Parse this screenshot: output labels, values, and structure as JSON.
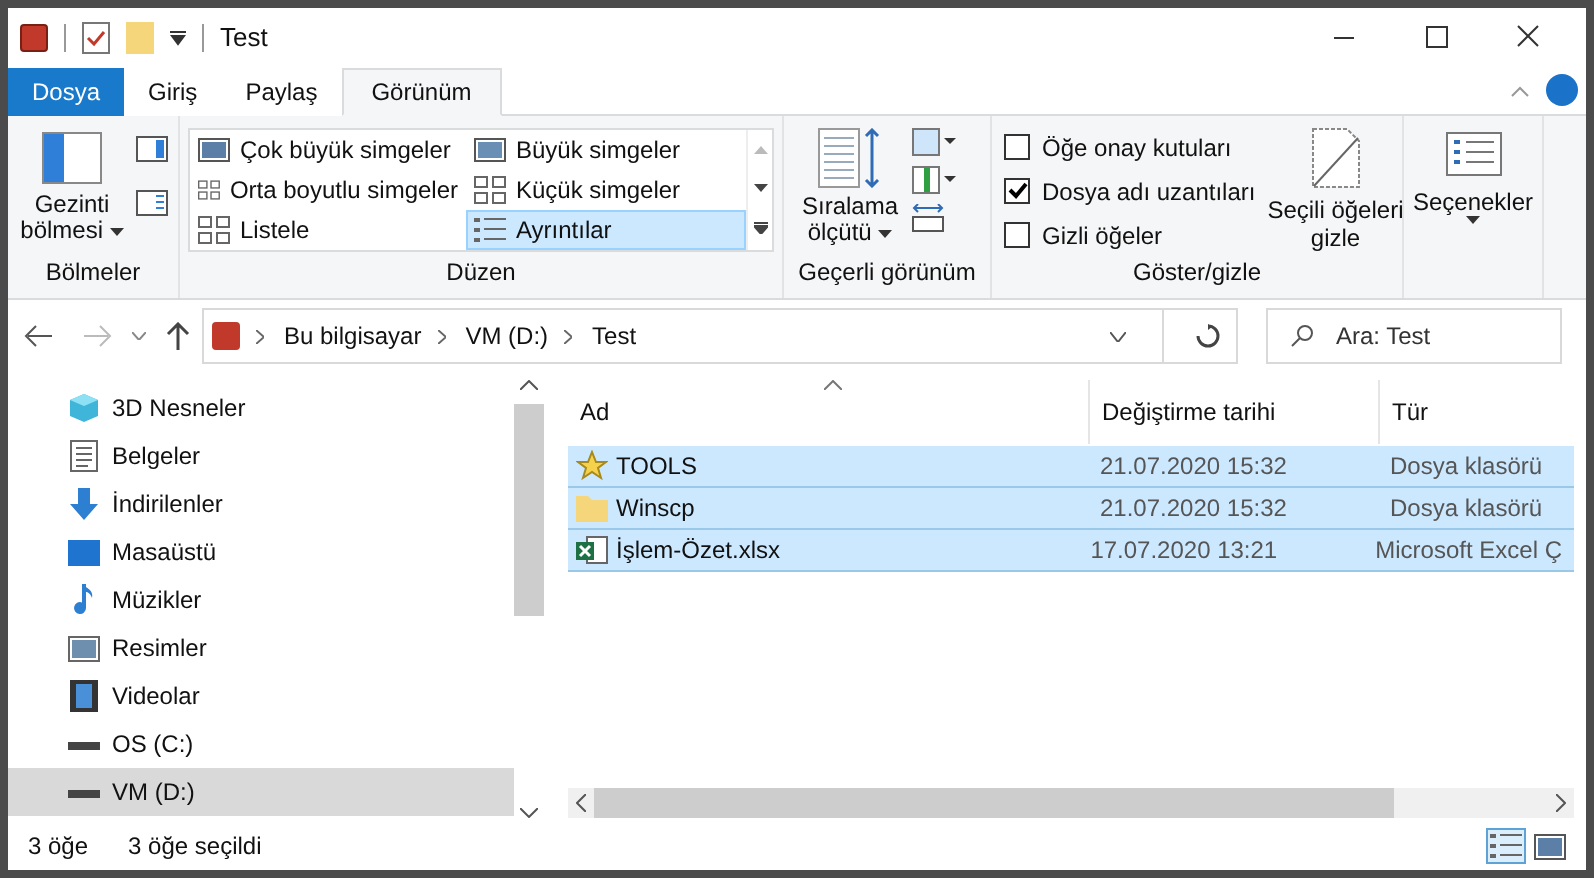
{
  "window": {
    "title": "Test"
  },
  "tabs": [
    {
      "label": "Dosya",
      "kind": "file",
      "selected": false
    },
    {
      "label": "Giriş",
      "kind": "normal",
      "selected": false
    },
    {
      "label": "Paylaş",
      "kind": "normal",
      "selected": false
    },
    {
      "label": "Görünüm",
      "kind": "normal",
      "selected": true
    }
  ],
  "ribbon": {
    "panes": {
      "nav_label": "Gezinti bölmesi",
      "group": "Bölmeler"
    },
    "layout": {
      "group": "Düzen",
      "options": [
        {
          "label": "Çok büyük simgeler",
          "selected": false
        },
        {
          "label": "Büyük simgeler",
          "selected": false
        },
        {
          "label": "Orta boyutlu simgeler",
          "selected": false
        },
        {
          "label": "Küçük simgeler",
          "selected": false
        },
        {
          "label": "Listele",
          "selected": false
        },
        {
          "label": "Ayrıntılar",
          "selected": true
        }
      ]
    },
    "current_view": {
      "sort_label": "Sıralama ölçütü",
      "group": "Geçerli görünüm"
    },
    "show_hide": {
      "group": "Göster/gizle",
      "checkboxes": [
        {
          "label": "Öğe onay kutuları",
          "checked": false
        },
        {
          "label": "Dosya adı uzantıları",
          "checked": true
        },
        {
          "label": "Gizli öğeler",
          "checked": false
        }
      ],
      "hide_selected": "Seçili öğeleri gizle"
    },
    "options": {
      "label": "Seçenekler"
    }
  },
  "address": {
    "crumbs": [
      "Bu bilgisayar",
      "VM (D:)",
      "Test"
    ],
    "search_placeholder": "Ara: Test"
  },
  "sidebar": {
    "items": [
      {
        "label": "3D Nesneler",
        "kind": "cube",
        "selected": false
      },
      {
        "label": "Belgeler",
        "kind": "doc",
        "selected": false
      },
      {
        "label": "İndirilenler",
        "kind": "download",
        "selected": false
      },
      {
        "label": "Masaüstü",
        "kind": "desktop",
        "selected": false
      },
      {
        "label": "Müzikler",
        "kind": "music",
        "selected": false
      },
      {
        "label": "Resimler",
        "kind": "picture",
        "selected": false
      },
      {
        "label": "Videolar",
        "kind": "video",
        "selected": false
      },
      {
        "label": "OS (C:)",
        "kind": "drive",
        "selected": false
      },
      {
        "label": "VM (D:)",
        "kind": "drive",
        "selected": true
      }
    ]
  },
  "table": {
    "columns": [
      "Ad",
      "Değiştirme tarihi",
      "Tür"
    ],
    "rows": [
      {
        "name": "TOOLS",
        "kind": "star",
        "modified": "21.07.2020 15:32",
        "type": "Dosya klasörü",
        "selected": true
      },
      {
        "name": "Winscp",
        "kind": "folder",
        "modified": "21.07.2020 15:32",
        "type": "Dosya klasörü",
        "selected": true
      },
      {
        "name": "İşlem-Özet.xlsx",
        "kind": "excel",
        "modified": "17.07.2020 13:21",
        "type": "Microsoft Excel Ç",
        "selected": true
      }
    ]
  },
  "status_bar": {
    "count": "3 öğe",
    "selection": "3 öğe seçildi"
  }
}
